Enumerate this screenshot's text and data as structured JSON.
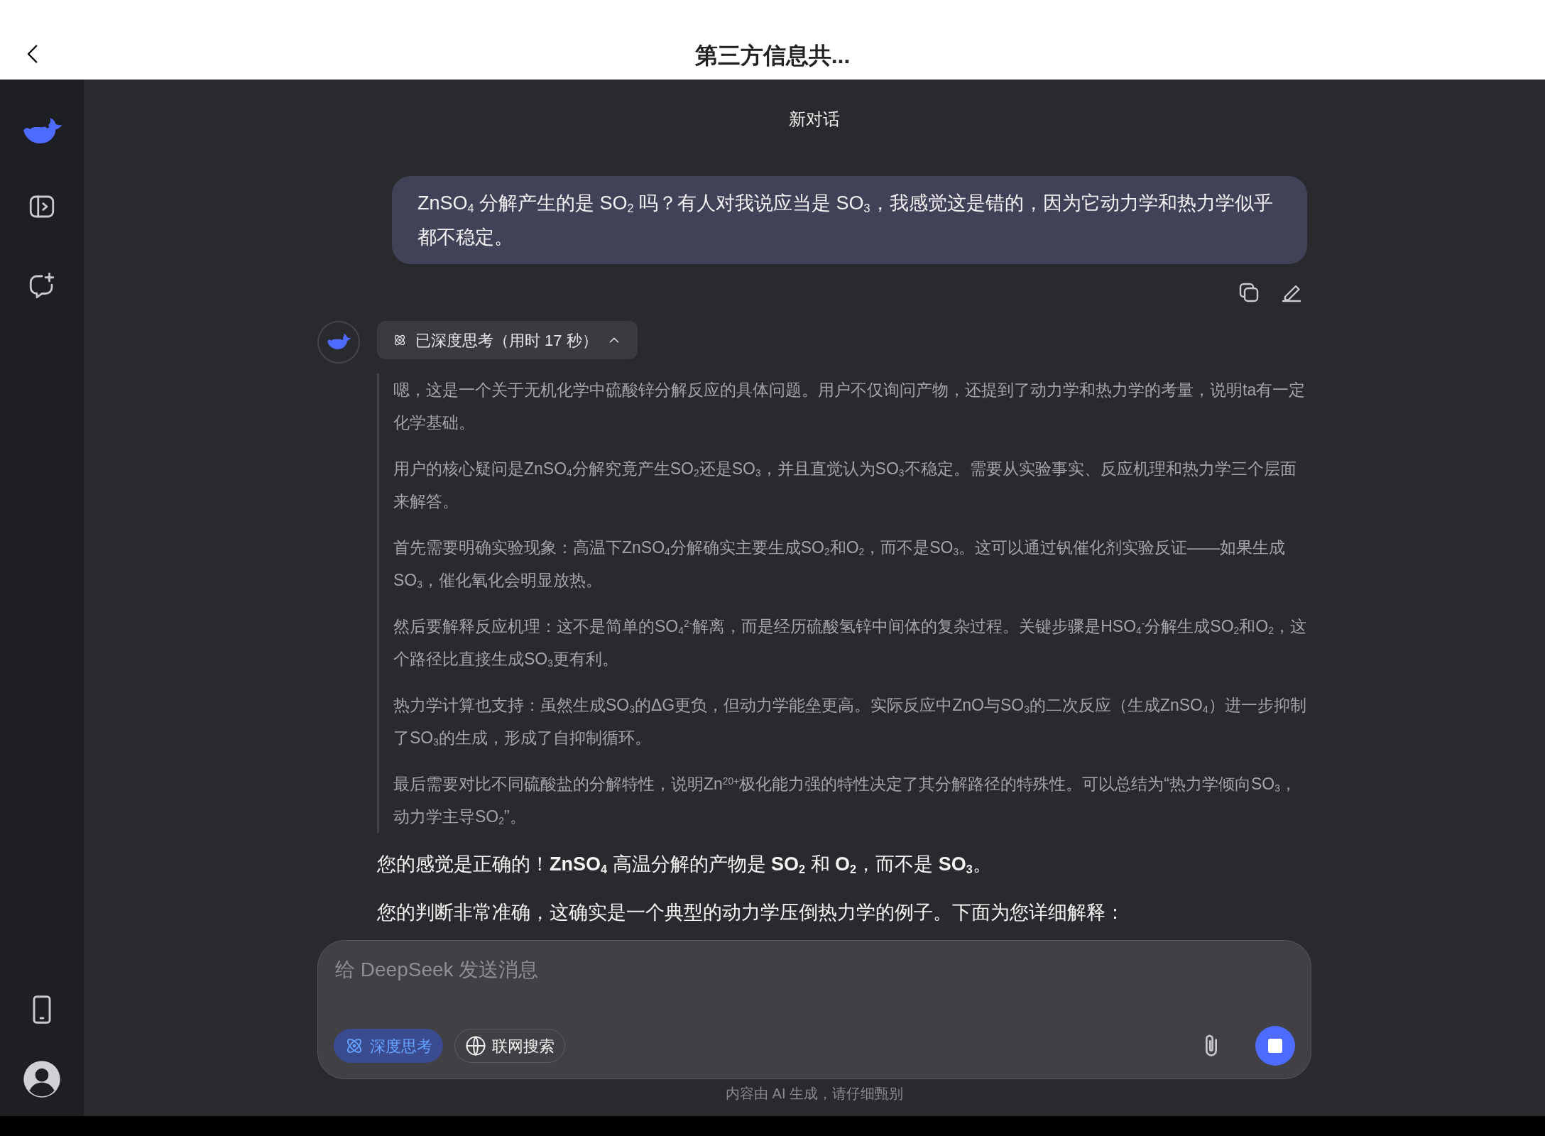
{
  "top_bar": {
    "title": "第三方信息共..."
  },
  "header": {
    "title": "新对话"
  },
  "messages": [
    {
      "kind": "user",
      "text": "ZnSO$_{4}$ 分解产生的是 SO$_{2}$ 吗？有人对我说应当是 SO$_{3}$，我感觉这是错的，因为它动力学和热力学似乎都不稳定。"
    },
    {
      "kind": "assistant",
      "thinking": {
        "label": "已深度思考（用时 17 秒）",
        "expanded": true,
        "paragraphs": [
          "嗯，这是一个关于无机化学中硫酸锌分解反应的具体问题。用户不仅询问产物，还提到了动力学和热力学的考量，说明ta有一定化学基础。",
          "用户的核心疑问是ZnSO$_{4}$分解究竟产生SO$_{2}$还是SO$_{3}$，并且直觉认为SO$_{3}$不稳定。需要从实验事实、反应机理和热力学三个层面来解答。",
          "首先需要明确实验现象：高温下ZnSO$_{4}$分解确实主要生成SO$_{2}$和O$_{2}$，而不是SO$_{3}$。这可以通过钒催化剂实验反证——如果生成SO$_{3}$，催化氧化会明显放热。",
          "然后要解释反应机理：这不是简单的SO$_{4}$$^{2-}$解离，而是经历硫酸氢锌中间体的复杂过程。关键步骤是HSO$_{4}$$^{-}$分解生成SO$_{2}$和O$_{2}$，这个路径比直接生成SO$_{3}$更有利。",
          "热力学计算也支持：虽然生成SO$_{3}$的ΔG更负，但动力学能垒更高。实际反应中ZnO与SO$_{3}$的二次反应（生成ZnSO$_{4}$）进一步抑制了SO$_{3}$的生成，形成了自抑制循环。",
          "最后需要对比不同硫酸盐的分解特性，说明Zn$^{20+}$极化能力强的特性决定了其分解路径的特殊性。可以总结为“热力学倾向SO$_{3}$，动力学主导SO$_{2}$”。"
        ]
      },
      "paragraphs": [
        "您的感觉是正确的！**ZnSO**$_{4}$ 高温分解的产物是 **SO**$_{2}$ 和 **O**$_{2}$，而不是 **SO**$_{3}$。",
        "您的判断非常准确，这确实是一个典型的动力学压倒热力学的例子。下面为您详细解释："
      ]
    }
  ],
  "composer": {
    "placeholder": "给 DeepSeek 发送消息",
    "toggles": [
      {
        "label": "深度思考",
        "selected": true
      },
      {
        "label": "联网搜索",
        "selected": false
      }
    ],
    "generating": true
  },
  "disclaimer": "内容由 AI 生成，请仔细甄别"
}
